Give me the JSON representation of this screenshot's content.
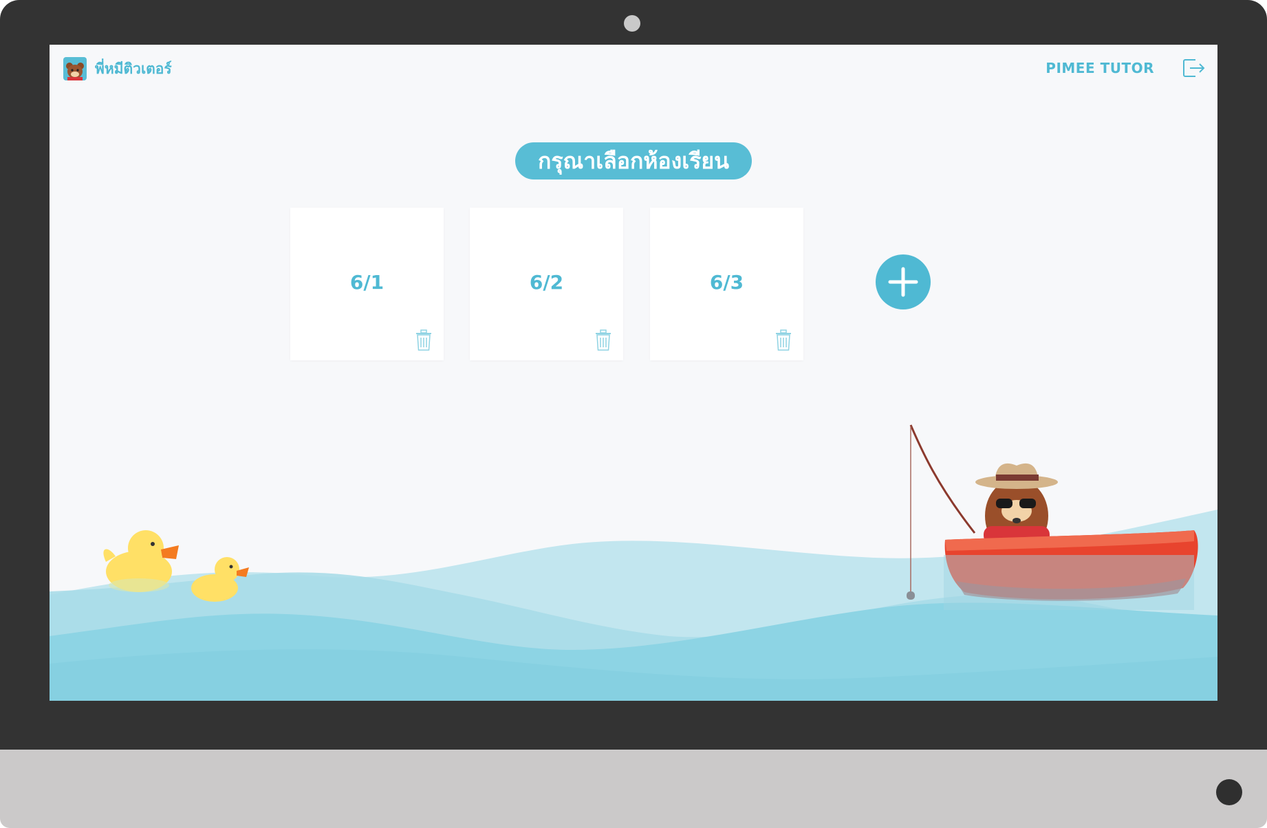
{
  "header": {
    "brand_name": "พี่หมีติวเตอร์",
    "user_name": "PIMEE TUTOR",
    "logo_icon": "bear-avatar-icon",
    "logout_icon": "logout-icon"
  },
  "main": {
    "title": "กรุณาเลือกห้องเรียน",
    "classrooms": [
      {
        "label": "6/1"
      },
      {
        "label": "6/2"
      },
      {
        "label": "6/3"
      }
    ],
    "add_icon": "plus-icon",
    "delete_icon": "trash-icon"
  },
  "colors": {
    "accent": "#4fb9d3",
    "background": "#f7f8fa",
    "water": "#8dd4e4",
    "boat": "#e8442e",
    "duck": "#ffe066"
  }
}
